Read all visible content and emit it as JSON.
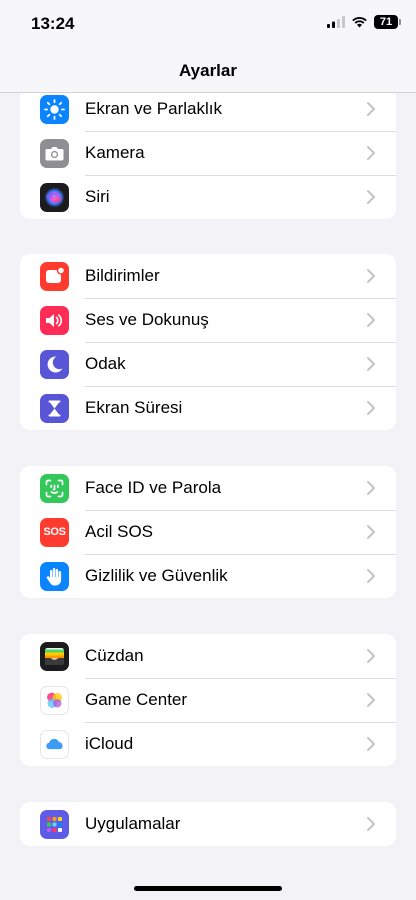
{
  "status": {
    "time": "13:24",
    "battery": "71"
  },
  "nav": {
    "title": "Ayarlar"
  },
  "groups": [
    {
      "items": [
        {
          "label": "Ekran ve Parlaklık",
          "icon": "sun-icon",
          "color": "#0a84ff"
        },
        {
          "label": "Kamera",
          "icon": "camera-icon",
          "color": "#8e8e93"
        },
        {
          "label": "Siri",
          "icon": "siri-icon",
          "color": "#1c1c1e"
        }
      ]
    },
    {
      "items": [
        {
          "label": "Bildirimler",
          "icon": "bell-icon",
          "color": "#ff3b30"
        },
        {
          "label": "Ses ve Dokunuş",
          "icon": "speaker-icon",
          "color": "#ff2d55"
        },
        {
          "label": "Odak",
          "icon": "moon-icon",
          "color": "#5856d6"
        },
        {
          "label": "Ekran Süresi",
          "icon": "hourglass-icon",
          "color": "#5856d6"
        }
      ]
    },
    {
      "items": [
        {
          "label": "Face ID ve Parola",
          "icon": "face-id-icon",
          "color": "#34c759"
        },
        {
          "label": "Acil SOS",
          "icon": "sos-icon",
          "text": "SOS",
          "color": "#ff3b30"
        },
        {
          "label": "Gizlilik ve Güvenlik",
          "icon": "hand-icon",
          "color": "#0a84ff"
        }
      ]
    },
    {
      "items": [
        {
          "label": "Cüzdan",
          "icon": "wallet-icon",
          "color": "#1c1c1e"
        },
        {
          "label": "Game Center",
          "icon": "game-center-icon",
          "color": "#ffffff"
        },
        {
          "label": "iCloud",
          "icon": "cloud-icon",
          "color": "#ffffff"
        }
      ]
    },
    {
      "items": [
        {
          "label": "Uygulamalar",
          "icon": "apps-grid-icon",
          "color": "#5e5ce6"
        }
      ]
    }
  ]
}
